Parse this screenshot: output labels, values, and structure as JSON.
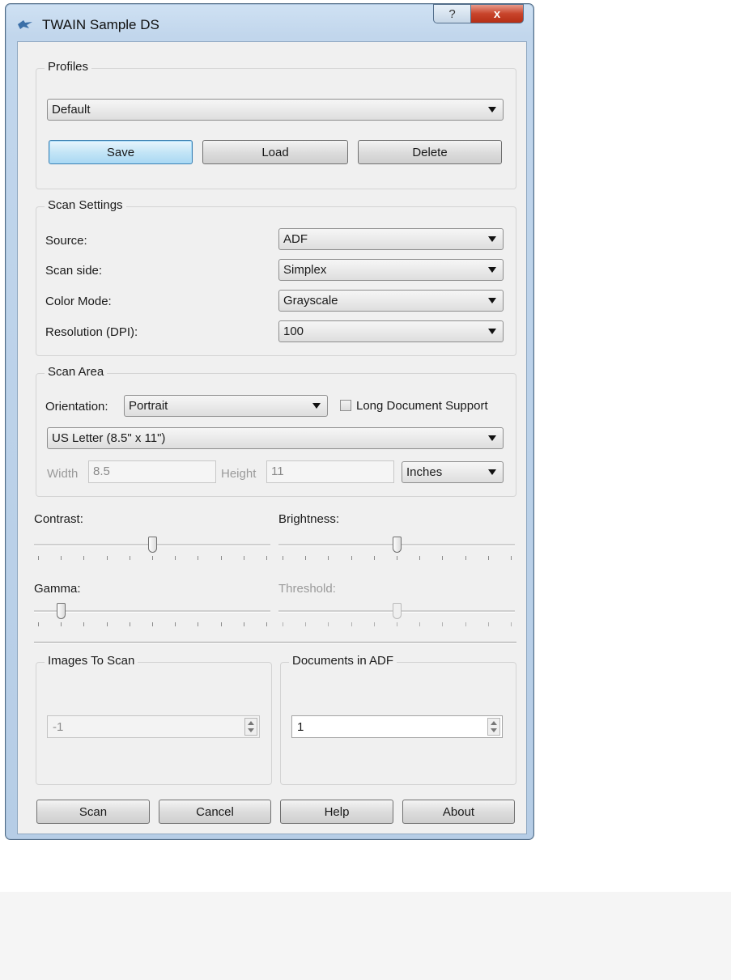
{
  "window": {
    "title": "TWAIN Sample DS",
    "help_glyph": "?",
    "close_glyph": "x"
  },
  "profiles": {
    "title": "Profiles",
    "selected": "Default",
    "save_label": "Save",
    "load_label": "Load",
    "delete_label": "Delete"
  },
  "scan_settings": {
    "title": "Scan Settings",
    "rows": [
      {
        "label": "Source:",
        "value": "ADF"
      },
      {
        "label": "Scan side:",
        "value": "Simplex"
      },
      {
        "label": "Color Mode:",
        "value": "Grayscale"
      },
      {
        "label": "Resolution (DPI):",
        "value": "100"
      }
    ]
  },
  "scan_area": {
    "title": "Scan Area",
    "orientation_label": "Orientation:",
    "orientation_value": "Portrait",
    "long_doc_label": "Long Document Support",
    "long_doc_checked": false,
    "paper_size": "US Letter (8.5\" x 11\")",
    "width_label": "Width",
    "width_value": "8.5",
    "height_label": "Height",
    "height_value": "11",
    "units": "Inches"
  },
  "sliders": {
    "contrast": {
      "label": "Contrast:",
      "position": 0.5,
      "enabled": true
    },
    "brightness": {
      "label": "Brightness:",
      "position": 0.5,
      "enabled": true
    },
    "gamma": {
      "label": "Gamma:",
      "position": 0.1,
      "enabled": true
    },
    "threshold": {
      "label": "Threshold:",
      "position": 0.5,
      "enabled": false
    }
  },
  "images_to_scan": {
    "title": "Images To Scan",
    "value": "-1",
    "enabled": false
  },
  "documents_in_adf": {
    "title": "Documents in ADF",
    "value": "1",
    "enabled": true
  },
  "footer": {
    "scan_label": "Scan",
    "cancel_label": "Cancel",
    "help_label": "Help",
    "about_label": "About"
  }
}
